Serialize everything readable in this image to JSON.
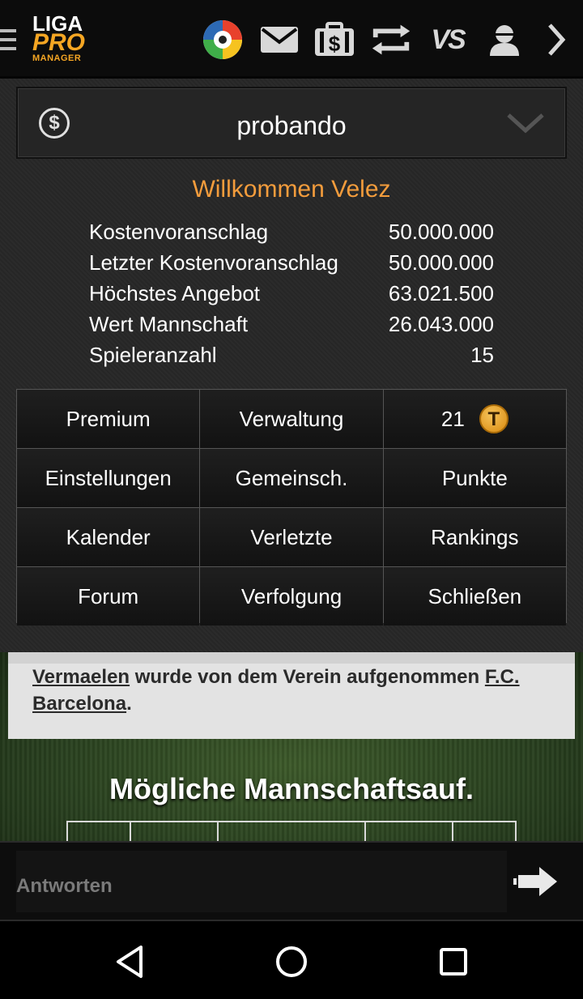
{
  "header": {
    "logo": {
      "line1": "LIGA",
      "line2": "PRO",
      "line3": "MANAGER"
    },
    "icons": [
      "menu-icon",
      "laliga-icon",
      "mail-icon",
      "market-money-icon",
      "transfers-icon",
      "versus-icon",
      "profile-icon",
      "chevron-right-icon"
    ],
    "versus_label": "VS"
  },
  "league_selector": {
    "name": "probando",
    "icon": "dollar-circle-icon"
  },
  "welcome": "Willkommen Velez",
  "stats": [
    {
      "label": "Kostenvoranschlag",
      "value": "50.000.000"
    },
    {
      "label": "Letzter Kostenvoranschlag",
      "value": "50.000.000"
    },
    {
      "label": "Höchstes Angebot",
      "value": "63.021.500"
    },
    {
      "label": "Wert Mannschaft",
      "value": "26.043.000"
    },
    {
      "label": "Spieleranzahl",
      "value": "15"
    }
  ],
  "menu_grid": {
    "premium": "Premium",
    "admin": "Verwaltung",
    "coins": "21",
    "settings": "Einstellungen",
    "community": "Gemeinsch.",
    "points": "Punkte",
    "calendar": "Kalender",
    "injured": "Verletzte",
    "rankings": "Rankings",
    "forum": "Forum",
    "tracking": "Verfolgung",
    "close": "Schließen"
  },
  "news": {
    "player": "Vermaelen",
    "text": " wurde von dem Verein aufgenommen ",
    "club": "F.C. Barcelona",
    "end": "."
  },
  "lineup_title": "Mögliche Mannschaftsauf.",
  "reply": {
    "placeholder": "Antworten"
  },
  "colors": {
    "accent": "#f39c3c",
    "panel": "#2b2b2b",
    "topbar": "#0c0c0c"
  }
}
